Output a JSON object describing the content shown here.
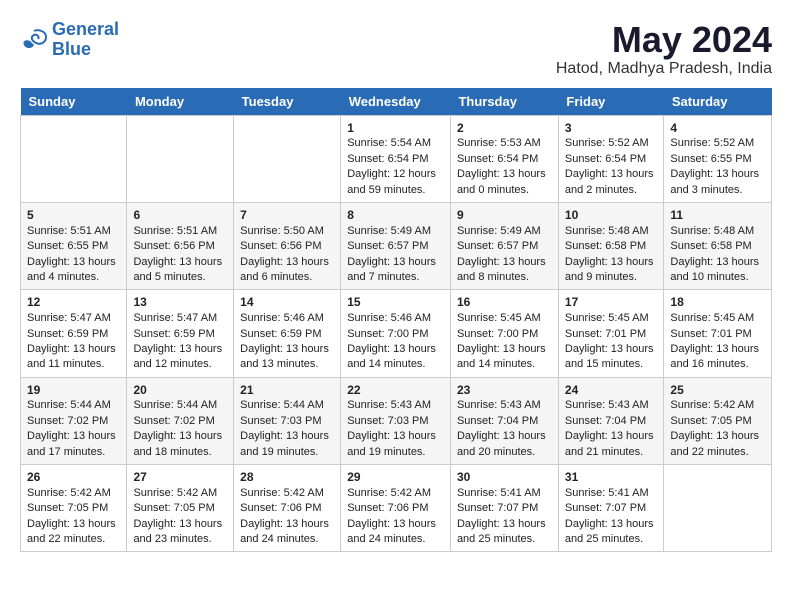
{
  "logo": {
    "line1": "General",
    "line2": "Blue"
  },
  "title": "May 2024",
  "location": "Hatod, Madhya Pradesh, India",
  "weekdays": [
    "Sunday",
    "Monday",
    "Tuesday",
    "Wednesday",
    "Thursday",
    "Friday",
    "Saturday"
  ],
  "weeks": [
    [
      {
        "day": "",
        "info": ""
      },
      {
        "day": "",
        "info": ""
      },
      {
        "day": "",
        "info": ""
      },
      {
        "day": "1",
        "info": "Sunrise: 5:54 AM\nSunset: 6:54 PM\nDaylight: 12 hours and 59 minutes."
      },
      {
        "day": "2",
        "info": "Sunrise: 5:53 AM\nSunset: 6:54 PM\nDaylight: 13 hours and 0 minutes."
      },
      {
        "day": "3",
        "info": "Sunrise: 5:52 AM\nSunset: 6:54 PM\nDaylight: 13 hours and 2 minutes."
      },
      {
        "day": "4",
        "info": "Sunrise: 5:52 AM\nSunset: 6:55 PM\nDaylight: 13 hours and 3 minutes."
      }
    ],
    [
      {
        "day": "5",
        "info": "Sunrise: 5:51 AM\nSunset: 6:55 PM\nDaylight: 13 hours and 4 minutes."
      },
      {
        "day": "6",
        "info": "Sunrise: 5:51 AM\nSunset: 6:56 PM\nDaylight: 13 hours and 5 minutes."
      },
      {
        "day": "7",
        "info": "Sunrise: 5:50 AM\nSunset: 6:56 PM\nDaylight: 13 hours and 6 minutes."
      },
      {
        "day": "8",
        "info": "Sunrise: 5:49 AM\nSunset: 6:57 PM\nDaylight: 13 hours and 7 minutes."
      },
      {
        "day": "9",
        "info": "Sunrise: 5:49 AM\nSunset: 6:57 PM\nDaylight: 13 hours and 8 minutes."
      },
      {
        "day": "10",
        "info": "Sunrise: 5:48 AM\nSunset: 6:58 PM\nDaylight: 13 hours and 9 minutes."
      },
      {
        "day": "11",
        "info": "Sunrise: 5:48 AM\nSunset: 6:58 PM\nDaylight: 13 hours and 10 minutes."
      }
    ],
    [
      {
        "day": "12",
        "info": "Sunrise: 5:47 AM\nSunset: 6:59 PM\nDaylight: 13 hours and 11 minutes."
      },
      {
        "day": "13",
        "info": "Sunrise: 5:47 AM\nSunset: 6:59 PM\nDaylight: 13 hours and 12 minutes."
      },
      {
        "day": "14",
        "info": "Sunrise: 5:46 AM\nSunset: 6:59 PM\nDaylight: 13 hours and 13 minutes."
      },
      {
        "day": "15",
        "info": "Sunrise: 5:46 AM\nSunset: 7:00 PM\nDaylight: 13 hours and 14 minutes."
      },
      {
        "day": "16",
        "info": "Sunrise: 5:45 AM\nSunset: 7:00 PM\nDaylight: 13 hours and 14 minutes."
      },
      {
        "day": "17",
        "info": "Sunrise: 5:45 AM\nSunset: 7:01 PM\nDaylight: 13 hours and 15 minutes."
      },
      {
        "day": "18",
        "info": "Sunrise: 5:45 AM\nSunset: 7:01 PM\nDaylight: 13 hours and 16 minutes."
      }
    ],
    [
      {
        "day": "19",
        "info": "Sunrise: 5:44 AM\nSunset: 7:02 PM\nDaylight: 13 hours and 17 minutes."
      },
      {
        "day": "20",
        "info": "Sunrise: 5:44 AM\nSunset: 7:02 PM\nDaylight: 13 hours and 18 minutes."
      },
      {
        "day": "21",
        "info": "Sunrise: 5:44 AM\nSunset: 7:03 PM\nDaylight: 13 hours and 19 minutes."
      },
      {
        "day": "22",
        "info": "Sunrise: 5:43 AM\nSunset: 7:03 PM\nDaylight: 13 hours and 19 minutes."
      },
      {
        "day": "23",
        "info": "Sunrise: 5:43 AM\nSunset: 7:04 PM\nDaylight: 13 hours and 20 minutes."
      },
      {
        "day": "24",
        "info": "Sunrise: 5:43 AM\nSunset: 7:04 PM\nDaylight: 13 hours and 21 minutes."
      },
      {
        "day": "25",
        "info": "Sunrise: 5:42 AM\nSunset: 7:05 PM\nDaylight: 13 hours and 22 minutes."
      }
    ],
    [
      {
        "day": "26",
        "info": "Sunrise: 5:42 AM\nSunset: 7:05 PM\nDaylight: 13 hours and 22 minutes."
      },
      {
        "day": "27",
        "info": "Sunrise: 5:42 AM\nSunset: 7:05 PM\nDaylight: 13 hours and 23 minutes."
      },
      {
        "day": "28",
        "info": "Sunrise: 5:42 AM\nSunset: 7:06 PM\nDaylight: 13 hours and 24 minutes."
      },
      {
        "day": "29",
        "info": "Sunrise: 5:42 AM\nSunset: 7:06 PM\nDaylight: 13 hours and 24 minutes."
      },
      {
        "day": "30",
        "info": "Sunrise: 5:41 AM\nSunset: 7:07 PM\nDaylight: 13 hours and 25 minutes."
      },
      {
        "day": "31",
        "info": "Sunrise: 5:41 AM\nSunset: 7:07 PM\nDaylight: 13 hours and 25 minutes."
      },
      {
        "day": "",
        "info": ""
      }
    ]
  ]
}
